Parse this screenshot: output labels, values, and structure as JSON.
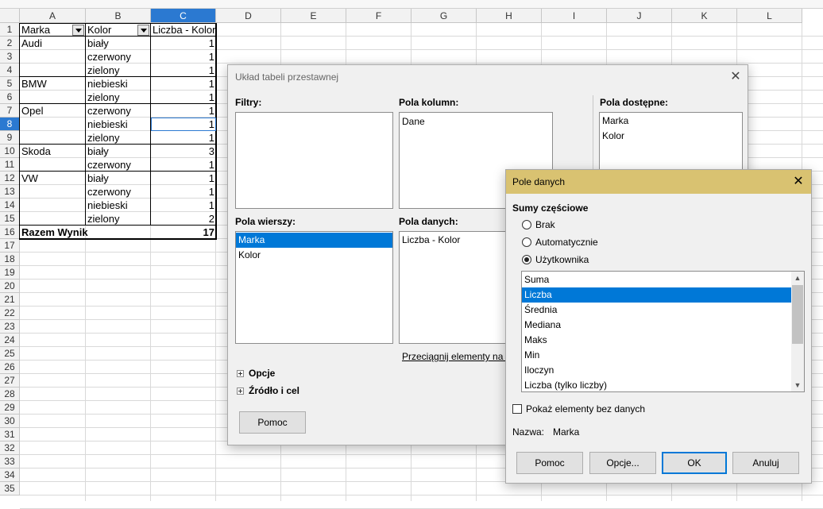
{
  "sheet": {
    "columns": [
      "A",
      "B",
      "C",
      "D",
      "E",
      "F",
      "G",
      "H",
      "I",
      "J",
      "K",
      "L"
    ],
    "rows": [
      "1",
      "2",
      "3",
      "4",
      "5",
      "6",
      "7",
      "8",
      "9",
      "10",
      "11",
      "12",
      "13",
      "14",
      "15",
      "16",
      "17",
      "18",
      "19",
      "20",
      "21",
      "22",
      "23",
      "24",
      "25",
      "26",
      "27",
      "28",
      "29",
      "30",
      "31",
      "32",
      "33",
      "34",
      "35"
    ],
    "selected_column": "C",
    "selected_row": "8",
    "pivot": {
      "header": {
        "marka": "Marka",
        "kolor": "Kolor",
        "count": "Liczba - Kolor"
      },
      "rows": [
        {
          "marka": "Audi",
          "kolor": "biały",
          "count": "1"
        },
        {
          "marka": "",
          "kolor": "czerwony",
          "count": "1"
        },
        {
          "marka": "",
          "kolor": "zielony",
          "count": "1"
        },
        {
          "marka": "BMW",
          "kolor": "niebieski",
          "count": "1"
        },
        {
          "marka": "",
          "kolor": "zielony",
          "count": "1"
        },
        {
          "marka": "Opel",
          "kolor": "czerwony",
          "count": "1"
        },
        {
          "marka": "",
          "kolor": "niebieski",
          "count": "1"
        },
        {
          "marka": "",
          "kolor": "zielony",
          "count": "1"
        },
        {
          "marka": "Skoda",
          "kolor": "biały",
          "count": "3"
        },
        {
          "marka": "",
          "kolor": "czerwony",
          "count": "1"
        },
        {
          "marka": "VW",
          "kolor": "biały",
          "count": "1"
        },
        {
          "marka": "",
          "kolor": "czerwony",
          "count": "1"
        },
        {
          "marka": "",
          "kolor": "niebieski",
          "count": "1"
        },
        {
          "marka": "",
          "kolor": "zielony",
          "count": "2"
        }
      ],
      "total_label": "Razem Wynik",
      "total_value": "17"
    }
  },
  "layout_dialog": {
    "title": "Układ tabeli przestawnej",
    "filters_label": "Filtry:",
    "column_fields_label": "Pola kolumn:",
    "column_fields": [
      "Dane"
    ],
    "available_fields_label": "Pola dostępne:",
    "available_fields": [
      "Marka",
      "Kolor"
    ],
    "row_fields_label": "Pola wierszy:",
    "row_fields": [
      "Marka",
      "Kolor"
    ],
    "data_fields_label": "Pola danych:",
    "data_fields": [
      "Liczba - Kolor"
    ],
    "drag_hint": "Przeciągnij elementy na p",
    "options_label": "Opcje",
    "source_label": "Źródło i cel",
    "help_button": "Pomoc"
  },
  "data_field_dialog": {
    "title": "Pole danych",
    "subtotals_label": "Sumy częściowe",
    "radio_none": "Brak",
    "radio_auto": "Automatycznie",
    "radio_user": "Użytkownika",
    "functions": [
      "Suma",
      "Liczba",
      "Średnia",
      "Mediana",
      "Maks",
      "Min",
      "Iloczyn",
      "Liczba (tylko liczby)"
    ],
    "selected_function": "Liczba",
    "show_empty_label": "Pokaż elementy bez danych",
    "name_label": "Nazwa:",
    "name_value": "Marka",
    "help_button": "Pomoc",
    "options_button": "Opcje...",
    "ok_button": "OK",
    "cancel_button": "Anuluj"
  }
}
